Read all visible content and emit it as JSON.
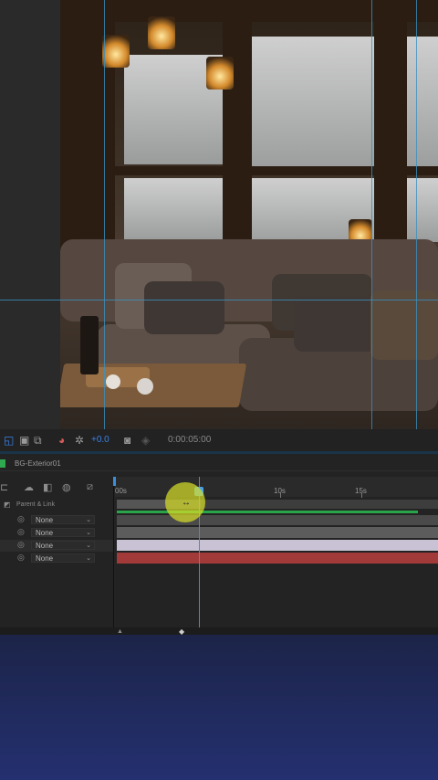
{
  "viewer": {
    "exposure_value": "+0.0",
    "timecode": "0:00:05:00"
  },
  "timeline": {
    "comp_name": "BG-Exterior01",
    "parent_header": "Parent & Link",
    "ruler": [
      "00s",
      "10s",
      "15s"
    ],
    "rows": [
      {
        "parent": "None"
      },
      {
        "parent": "None"
      },
      {
        "parent": "None"
      },
      {
        "parent": "None"
      }
    ]
  },
  "colors": {
    "label_green": "#2fa84f",
    "playhead_blue": "#3b8fd9",
    "layer_red": "#a33a3a",
    "layer_lilac": "#c8c2d4",
    "touch_indicator": "#d6de28"
  },
  "icons": [
    "region-of-interest-icon",
    "transparency-grid-icon",
    "mask-icon",
    "color-channel-icon",
    "exposure-reset-icon",
    "snapshot-icon",
    "show-snapshot-icon",
    "search-icon",
    "comp-flowchart-icon",
    "draft-3d-icon",
    "motion-blur-icon",
    "graph-editor-icon",
    "parent-pickwhip-icon",
    "playhead-icon",
    "zoom-slider-icon"
  ]
}
